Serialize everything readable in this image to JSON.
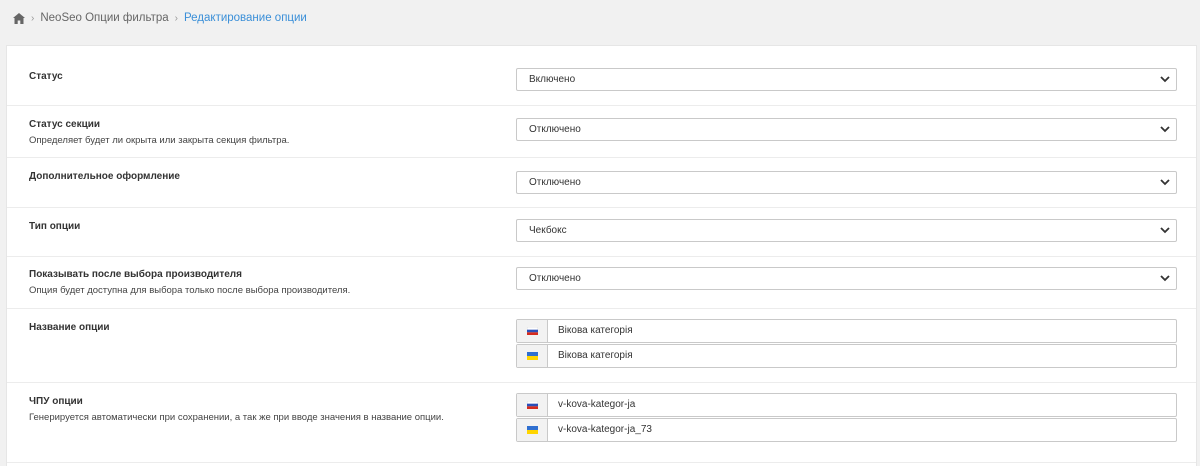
{
  "breadcrumb": {
    "items": [
      "NeoSeo Опции фильтра",
      "Редактирование опции"
    ]
  },
  "form": {
    "status": {
      "label": "Статус",
      "value": "Включено"
    },
    "section_status": {
      "label": "Статус секции",
      "hint": "Определяет будет ли окрыта или закрыта секция фильтра.",
      "value": "Отключено"
    },
    "extra_design": {
      "label": "Дополнительное оформление",
      "value": "Отключено"
    },
    "option_type": {
      "label": "Тип опции",
      "value": "Чекбокс"
    },
    "show_after_manufacturer": {
      "label": "Показывать после выбора производителя",
      "hint": "Опция будет доступна для выбора только после выбора производителя.",
      "value": "Отключено"
    },
    "option_name": {
      "label": "Название опции",
      "values": [
        "Вікова категорія",
        "Вікова категорія"
      ]
    },
    "option_seo_url": {
      "label": "ЧПУ опции",
      "hint": "Генерируется автоматически при сохранении, а так же при вводе значения в название опции.",
      "values": [
        "v-kova-kategor-ja",
        "v-kova-kategor-ja_73"
      ]
    }
  },
  "icons": {
    "home": "home-icon",
    "chevron": "chevron-down-icon",
    "flags": [
      "ru-flag-icon",
      "ua-flag-icon"
    ]
  },
  "colors": {
    "link": "#3a8fd8",
    "ua_blue": "#2f6fd0",
    "ua_yellow": "#ffd500",
    "ru_white": "#ffffff",
    "ru_blue": "#2a4fb8",
    "ru_red": "#d52b1e"
  }
}
